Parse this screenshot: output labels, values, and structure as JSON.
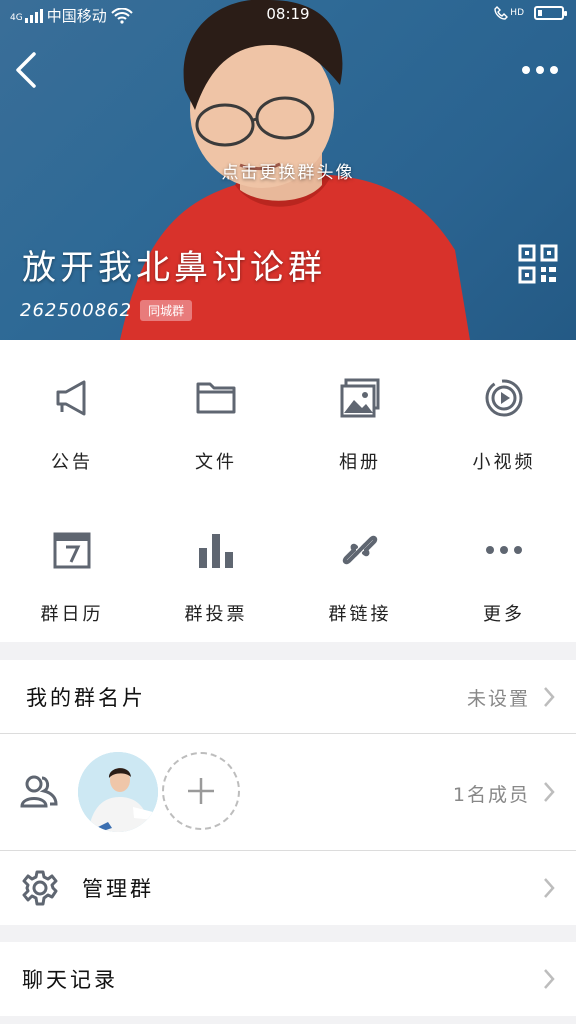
{
  "status": {
    "signal": "4G",
    "carrier": "中国移动",
    "time": "08:19",
    "call_label": "HD",
    "battery_level": 0.2
  },
  "header": {
    "change_avatar": "点击更换群头像",
    "group_name": "放开我北鼻讨论群",
    "group_id": "262500862",
    "badge": "同城群"
  },
  "grid": [
    {
      "label": "公告",
      "icon": "megaphone-icon"
    },
    {
      "label": "文件",
      "icon": "folder-icon"
    },
    {
      "label": "相册",
      "icon": "photo-album-icon"
    },
    {
      "label": "小视频",
      "icon": "video-play-icon"
    },
    {
      "label": "群日历",
      "icon": "calendar-icon"
    },
    {
      "label": "群投票",
      "icon": "bar-chart-icon"
    },
    {
      "label": "群链接",
      "icon": "link-icon"
    },
    {
      "label": "更多",
      "icon": "more-dots-icon"
    }
  ],
  "rows": {
    "card_label": "我的群名片",
    "card_value": "未设置",
    "members_count": "1名成员",
    "manage_label": "管理群",
    "history_label": "聊天记录"
  },
  "colors": {
    "icon": "#5f6671",
    "header_bg": "#2f6a96",
    "badge": "#e87b7b",
    "shirt": "#d8322b"
  }
}
